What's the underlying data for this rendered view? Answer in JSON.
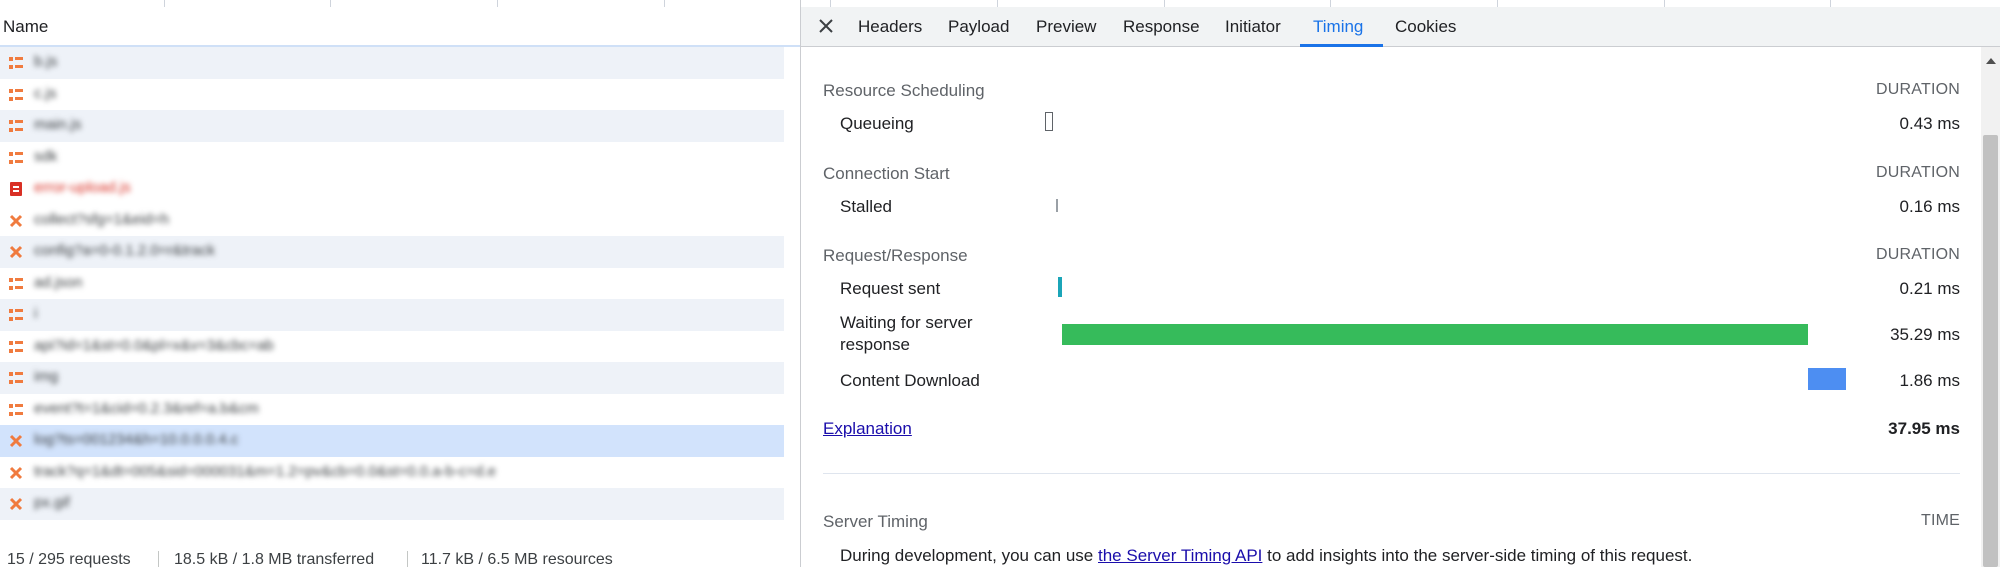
{
  "list": {
    "header": "Name",
    "rows": [
      {
        "name": "b.js",
        "icon": "script",
        "style": "alt"
      },
      {
        "name": "c.js",
        "icon": "script",
        "style": "plain"
      },
      {
        "name": "main.js",
        "icon": "script",
        "style": "alt"
      },
      {
        "name": "sdk",
        "icon": "script",
        "style": "plain"
      },
      {
        "name": "error-upload.js",
        "icon": "error",
        "style": "plain"
      },
      {
        "name": "collect?sfg=1&eid=h",
        "icon": "fetch",
        "style": "plain"
      },
      {
        "name": "config?a=0-0.1.2.0=r&track",
        "icon": "fetch",
        "style": "alt"
      },
      {
        "name": "ad.json",
        "icon": "script",
        "style": "plain"
      },
      {
        "name": "i",
        "icon": "script",
        "style": "alt"
      },
      {
        "name": "api?id=1&st=0.0&pl=x&v=3&cbc=ab",
        "icon": "script",
        "style": "plain"
      },
      {
        "name": "img",
        "icon": "script",
        "style": "alt"
      },
      {
        "name": "event?t=1&cid=0.2.3&ref=a.b&cm",
        "icon": "script",
        "style": "plain"
      },
      {
        "name": "log?ts=001234&h=10.0.0.0.4.c",
        "icon": "fetch",
        "style": "selected"
      },
      {
        "name": "track?q=1&dt=005&sid=000031&m=1.2=pv&cb=0.0&st=0.0.a-b-c=d.e",
        "icon": "fetch",
        "style": "plain"
      },
      {
        "name": "px.gif",
        "icon": "fetch",
        "style": "alt"
      }
    ],
    "status": {
      "requests": "15 / 295 requests",
      "transferred": "18.5 kB / 1.8 MB transferred",
      "resources": "11.7 kB / 6.5 MB resources"
    }
  },
  "tabs": {
    "close_icon": "close-icon",
    "items": [
      "Headers",
      "Payload",
      "Preview",
      "Response",
      "Initiator",
      "Timing",
      "Cookies"
    ],
    "active": "Timing"
  },
  "timing": {
    "duration_label": "DURATION",
    "sections": [
      {
        "title": "Resource Scheduling",
        "rows": [
          {
            "label": "Queueing",
            "value": "0.43 ms"
          }
        ]
      },
      {
        "title": "Connection Start",
        "rows": [
          {
            "label": "Stalled",
            "value": "0.16 ms"
          }
        ]
      },
      {
        "title": "Request/Response",
        "rows": [
          {
            "label": "Request sent",
            "value": "0.21 ms",
            "color": "#1ba5b8"
          },
          {
            "label": "Waiting for server response",
            "value": "35.29 ms",
            "color": "#36bb5b"
          },
          {
            "label": "Content Download",
            "value": "1.86 ms",
            "color": "#4d8ef2"
          }
        ]
      }
    ],
    "explanation_link": "Explanation",
    "total": "37.95 ms"
  },
  "server_timing": {
    "title": "Server Timing",
    "time_label": "TIME",
    "note_before": "During development, you can use ",
    "note_link": "the Server Timing API",
    "note_after": " to add insights into the server-side timing of this request."
  },
  "colors": {
    "accent": "#1a73e8",
    "selected_row": "#d2e3fc",
    "alt_row": "#eef2f8",
    "error": "#d93025",
    "request_icon": "#f07b3f"
  }
}
